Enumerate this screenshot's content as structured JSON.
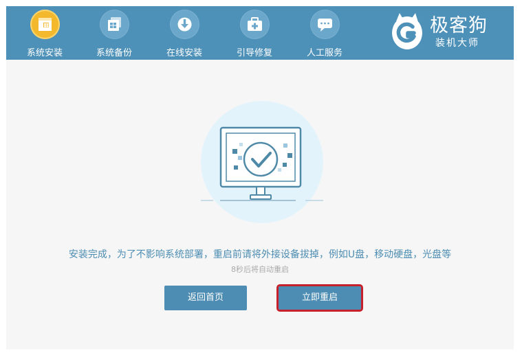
{
  "app": {
    "brand_name": "极客狗",
    "brand_subtitle": "装机大师",
    "brand_logo_icon": "dog-g-logo-icon"
  },
  "nav": {
    "items": [
      {
        "label": "系统安装",
        "icon": "package-box-icon",
        "active": true
      },
      {
        "label": "系统备份",
        "icon": "stacked-windows-icon",
        "active": false
      },
      {
        "label": "在线安装",
        "icon": "cloud-download-icon",
        "active": false
      },
      {
        "label": "引导修复",
        "icon": "toolbox-repair-icon",
        "active": false
      },
      {
        "label": "人工服务",
        "icon": "chat-bubble-icon",
        "active": false
      }
    ]
  },
  "main": {
    "illustration_icon": "monitor-checkmark-icon",
    "message": "安装完成，为了不影响系统部署，重启前请将外接设备拔掉，例如U盘，移动硬盘，光盘等",
    "countdown": "8秒后将自动重启"
  },
  "buttons": {
    "home_label": "返回首页",
    "restart_label": "立即重启"
  },
  "colors": {
    "header": "#4d90b8",
    "active_nav": "#f3b82b",
    "accent": "#4d8db3",
    "highlight_border": "#c8202a"
  }
}
